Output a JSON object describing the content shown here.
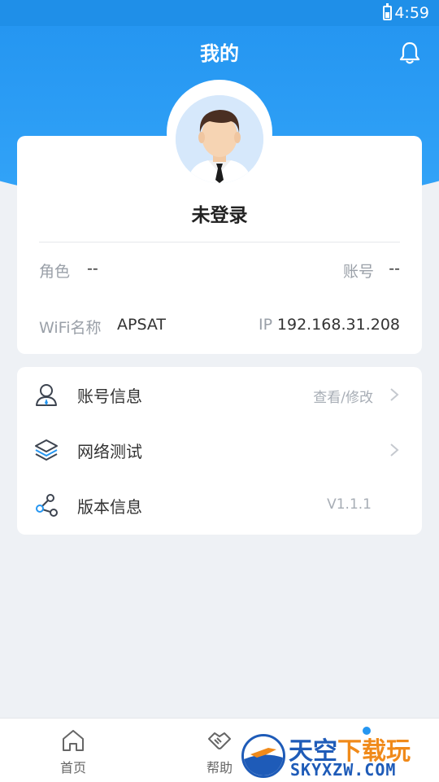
{
  "status_bar": {
    "time": "4:59"
  },
  "header": {
    "title": "我的",
    "icons": {
      "notifications": "bell-icon"
    }
  },
  "profile": {
    "username": "未登录",
    "avatar": "avatar-man",
    "fields": {
      "role_label": "角色",
      "role_value": "--",
      "account_label": "账号",
      "account_value": "--",
      "wifi_label": "WiFi名称",
      "wifi_value": "APSAT",
      "ip_label": "IP",
      "ip_value": "192.168.31.208"
    }
  },
  "menu": [
    {
      "label": "账号信息",
      "right": "查看/修改",
      "icon": "user-icon",
      "chevron": true
    },
    {
      "label": "网络测试",
      "right": "",
      "icon": "layers-icon",
      "chevron": true
    },
    {
      "label": "版本信息",
      "right": "V1.1.1",
      "icon": "share-nodes-icon",
      "chevron": false
    }
  ],
  "bottom_nav": [
    {
      "label": "首页",
      "icon": "home-icon"
    },
    {
      "label": "帮助",
      "icon": "handshake-icon"
    }
  ],
  "watermark": {
    "top_a": "天空",
    "top_b": "下载玩",
    "bottom": "SKYXZW.COM"
  },
  "colors": {
    "primary": "#2596f1",
    "background": "#eef1f5",
    "text": "#333333",
    "muted": "#9aa0a8"
  }
}
